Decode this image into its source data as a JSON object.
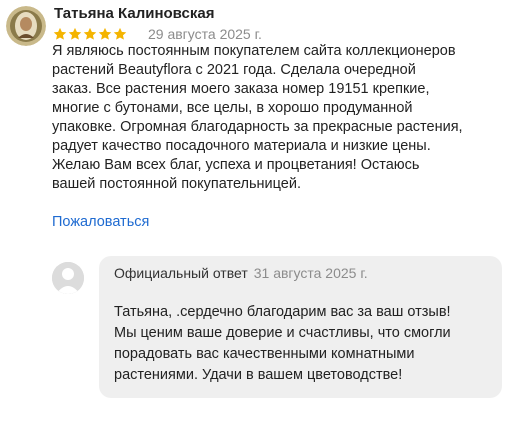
{
  "review": {
    "author": "Татьяна Калиновская",
    "rating": 5,
    "date": "29 августа 2025 г.",
    "text": "Я  являюсь постоянным покупателем сайта  коллекционеров\nрастений   Beautyflora с 2021 года. Сделала  очередной\nзаказ. Все растения моего заказа  номер 19151 крепкие,\nмногие с бутонами, все целы,  в хорошо продуманной\nупаковке. Огромная благодарность за прекрасные растения,\nрадует качество посадочного материала и низкие цены.\nЖелаю Вам  всех благ, успеха и процветания! Остаюсь\nвашей постоянной покупательницей.",
    "complain_label": "Пожаловаться",
    "avatar_icon": "user-photo-avatar",
    "star_icon": "star-icon"
  },
  "reply": {
    "title": "Официальный ответ",
    "date": "31 августа 2025 г.",
    "text": "Татьяна, .сердечно благодарим вас за ваш отзыв!\nМы ценим ваше доверие и счастливы, что смогли\nпорадовать вас качественными комнатными\nрастениями. Удачи в вашем цветоводстве!",
    "avatar_icon": "default-user-avatar"
  },
  "colors": {
    "star": "#f4b400",
    "link": "#1f6bd1",
    "muted": "#8c8c8c",
    "reply_bg": "#efefef"
  }
}
